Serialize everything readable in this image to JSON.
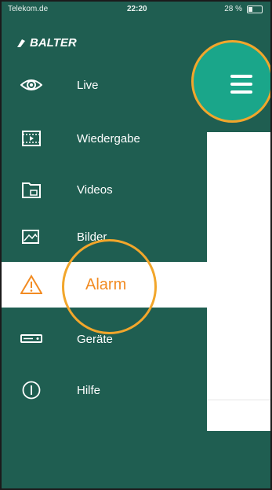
{
  "status_bar": {
    "carrier": "Telekom.de",
    "time": "22:20",
    "battery": "28 %"
  },
  "app": {
    "brand": "BALTER"
  },
  "menu": {
    "items": [
      {
        "label": "Live",
        "icon": "eye-icon",
        "active": false
      },
      {
        "label": "Wiedergabe",
        "icon": "playback-icon",
        "active": false
      },
      {
        "label": "Videos",
        "icon": "video-folder-icon",
        "active": false
      },
      {
        "label": "Bilder",
        "icon": "pictures-icon",
        "active": false
      },
      {
        "label": "Alarm",
        "icon": "warning-icon",
        "active": true
      },
      {
        "label": "Geräte",
        "icon": "device-icon",
        "active": false
      },
      {
        "label": "Hilfe",
        "icon": "info-icon",
        "active": false
      }
    ]
  },
  "colors": {
    "sidebar": "#1f5e51",
    "accent_orange": "#f28b22",
    "hamburger_bg": "#1aa68a",
    "highlight_ring": "#f2a62b"
  }
}
